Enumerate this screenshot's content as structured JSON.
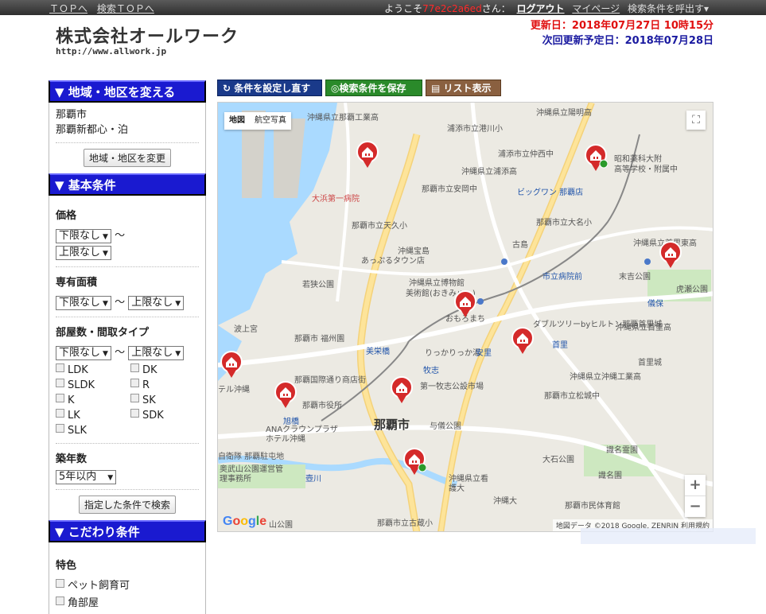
{
  "topbar": {
    "top_link": "ＴＯＰへ",
    "search_top_link": "検索ＴＯＰへ",
    "welcome_prefix": "ようこそ",
    "user_id": "77e2c2a6ed",
    "welcome_suffix": "さん：",
    "logout": "ログアウト",
    "mypage": "マイページ",
    "call_conditions": "検索条件を呼出す▾"
  },
  "header": {
    "company": "株式会社オールワーク",
    "url": "http://www.allwork.jp",
    "updated": "更新日：2018年07月27日 10時15分",
    "next_update": "次回更新予定日：2018年07月28日"
  },
  "area_section": {
    "title": "▼ 地域・地区を変える",
    "city": "那覇市",
    "district": "那覇新都心・泊",
    "change_button": "地域・地区を変更"
  },
  "basic_section": {
    "title": "▼ 基本条件",
    "price_label": "価格",
    "price_min": "下限なし",
    "tilde": "～",
    "price_max": "上限なし",
    "area_label": "専有面積",
    "area_min": "下限なし",
    "area_max": "上限なし",
    "rooms_label": "部屋数・間取タイプ",
    "rooms_min": "下限なし",
    "rooms_max": "上限なし",
    "layouts": [
      "LDK",
      "DK",
      "SLDK",
      "R",
      "K",
      "SK",
      "LK",
      "SDK",
      "SLK"
    ],
    "age_label": "築年数",
    "age_value": "5年以内",
    "search_button": "指定した条件で検索"
  },
  "kodawari_section": {
    "title": "▼ こだわり条件",
    "feature_label": "特色",
    "features": [
      "ペット飼育可",
      "角部屋"
    ]
  },
  "map_toolbar": {
    "reset": "条件を設定し直す",
    "save": "検索条件を保存",
    "list": "リスト表示"
  },
  "map": {
    "type_map": "地図",
    "type_satellite": "航空写真",
    "google": "Google",
    "attribution": "地図データ ©2018 Google, ZENRIN  利用規約",
    "zoom_in": "+",
    "zoom_out": "−",
    "fullscreen_icon": "⛶",
    "labels": {
      "naha_city": "那覇市",
      "l1": "沖縄県立那覇工業高",
      "l2": "沖縄県立陽明高",
      "l3": "浦添市立港川小",
      "l4": "浦添市立仲西中",
      "l5": "昭和薬科大附",
      "l6": "高等学校・附属中",
      "l7": "沖縄県立浦添高",
      "l8": "那覇市立安岡中",
      "l9": "ビッグワン 那覇店",
      "l10": "大浜第一病院",
      "l11": "那覇市立天久小",
      "l12": "那覇市立大名小",
      "l13": "沖縄宝島",
      "l14": "あっぷるタウン店",
      "l15": "古島",
      "l16": "沖縄県立首里東高",
      "l17": "若狭公園",
      "l18": "沖縄県立博物館",
      "l19": "美術館(おきみゅー)",
      "l20": "市立病院前",
      "l21": "末吉公園",
      "l22": "虎瀬公園",
      "l23": "儀保",
      "l24": "おもろまち",
      "l25": "ダブルツリーbyヒルトン那覇首里城",
      "l26": "沖縄県立首里高",
      "l27": "波上宮",
      "l28": "那覇市 福州園",
      "l29": "美栄橋",
      "l30": "りっかりっか湯",
      "l31": "首里",
      "l32": "首里城",
      "l33": "牧志",
      "l34": "安里",
      "l35": "那覇国際通り商店街",
      "l36": "第一牧志公設市場",
      "l37": "沖縄県立沖縄工業高",
      "l38": "那覇市立松城中",
      "l39": "那覇市役所",
      "l40": "旭橋",
      "l41": "ANAクラウンプラザホテル沖縄",
      "l42": "与儀公園",
      "l43": "識名霊園",
      "l44": "自衛隊 那覇駐屯地",
      "l45": "大石公園",
      "l46": "識名園",
      "l47": "奥武山公園運営管理事務所",
      "l48": "壺川",
      "l49": "沖縄県立看護大",
      "l50": "沖縄大",
      "l51": "那覇市民体育館",
      "l52": "山公園",
      "l53": "那覇市立古蔵小",
      "l54": "テル沖縄"
    }
  }
}
